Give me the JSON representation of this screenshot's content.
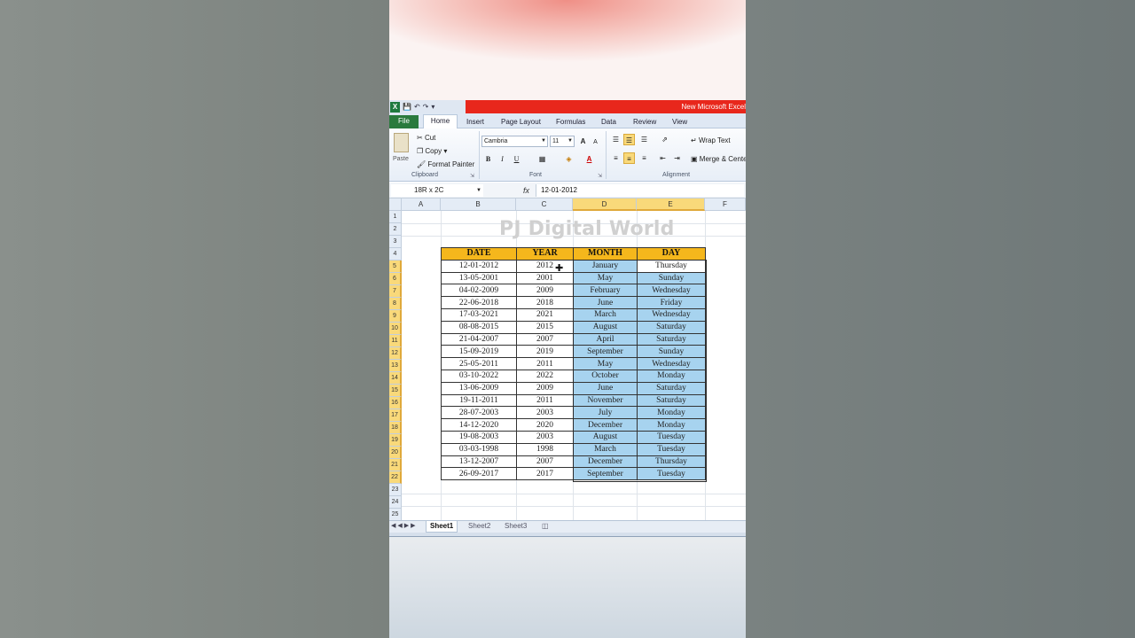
{
  "app": {
    "title": "New Microsoft Excel",
    "logo_letter": "X",
    "qat": [
      "save-icon",
      "undo-icon",
      "redo-icon",
      "customize-icon"
    ]
  },
  "tabs": [
    "File",
    "Home",
    "Insert",
    "Page Layout",
    "Formulas",
    "Data",
    "Review",
    "View"
  ],
  "ribbon": {
    "clipboard": {
      "label": "Clipboard",
      "paste": "Paste",
      "cut": "Cut",
      "copy": "Copy",
      "format_painter": "Format Painter"
    },
    "font": {
      "label": "Font",
      "font_name": "Cambria",
      "font_size": "11",
      "bold": "B",
      "italic": "I",
      "underline": "U",
      "grow": "A",
      "shrink": "A",
      "font_color": "A"
    },
    "alignment": {
      "label": "Alignment",
      "wrap_text": "Wrap Text",
      "merge_center": "Merge & Center"
    }
  },
  "formula_bar": {
    "name_box": "18R x 2C",
    "fx": "fx",
    "content": "12-01-2012"
  },
  "grid": {
    "columns": [
      "A",
      "B",
      "C",
      "D",
      "E",
      "F"
    ],
    "rows": [
      "1",
      "2",
      "3",
      "4",
      "5",
      "6",
      "7",
      "8",
      "9",
      "10",
      "11",
      "12",
      "13",
      "14",
      "15",
      "16",
      "17",
      "18",
      "19",
      "20",
      "21",
      "22",
      "23",
      "24",
      "25"
    ],
    "watermark": "PJ Digital World"
  },
  "table": {
    "headers": [
      "DATE",
      "YEAR",
      "MONTH",
      "DAY"
    ],
    "rows": [
      [
        "12-01-2012",
        "2012",
        "January",
        "Thursday"
      ],
      [
        "13-05-2001",
        "2001",
        "May",
        "Sunday"
      ],
      [
        "04-02-2009",
        "2009",
        "February",
        "Wednesday"
      ],
      [
        "22-06-2018",
        "2018",
        "June",
        "Friday"
      ],
      [
        "17-03-2021",
        "2021",
        "March",
        "Wednesday"
      ],
      [
        "08-08-2015",
        "2015",
        "August",
        "Saturday"
      ],
      [
        "21-04-2007",
        "2007",
        "April",
        "Saturday"
      ],
      [
        "15-09-2019",
        "2019",
        "September",
        "Sunday"
      ],
      [
        "25-05-2011",
        "2011",
        "May",
        "Wednesday"
      ],
      [
        "03-10-2022",
        "2022",
        "October",
        "Monday"
      ],
      [
        "13-06-2009",
        "2009",
        "June",
        "Saturday"
      ],
      [
        "19-11-2011",
        "2011",
        "November",
        "Saturday"
      ],
      [
        "28-07-2003",
        "2003",
        "July",
        "Monday"
      ],
      [
        "14-12-2020",
        "2020",
        "December",
        "Monday"
      ],
      [
        "19-08-2003",
        "2003",
        "August",
        "Tuesday"
      ],
      [
        "03-03-1998",
        "1998",
        "March",
        "Tuesday"
      ],
      [
        "13-12-2007",
        "2007",
        "December",
        "Thursday"
      ],
      [
        "26-09-2017",
        "2017",
        "September",
        "Tuesday"
      ]
    ]
  },
  "sheets": [
    "Sheet1",
    "Sheet2",
    "Sheet3"
  ],
  "colors": {
    "header_fill": "#f5b71c",
    "selection_fill": "#a7d3ef",
    "title_bar_red": "#e8271c",
    "file_tab": "#2a7a3d"
  }
}
